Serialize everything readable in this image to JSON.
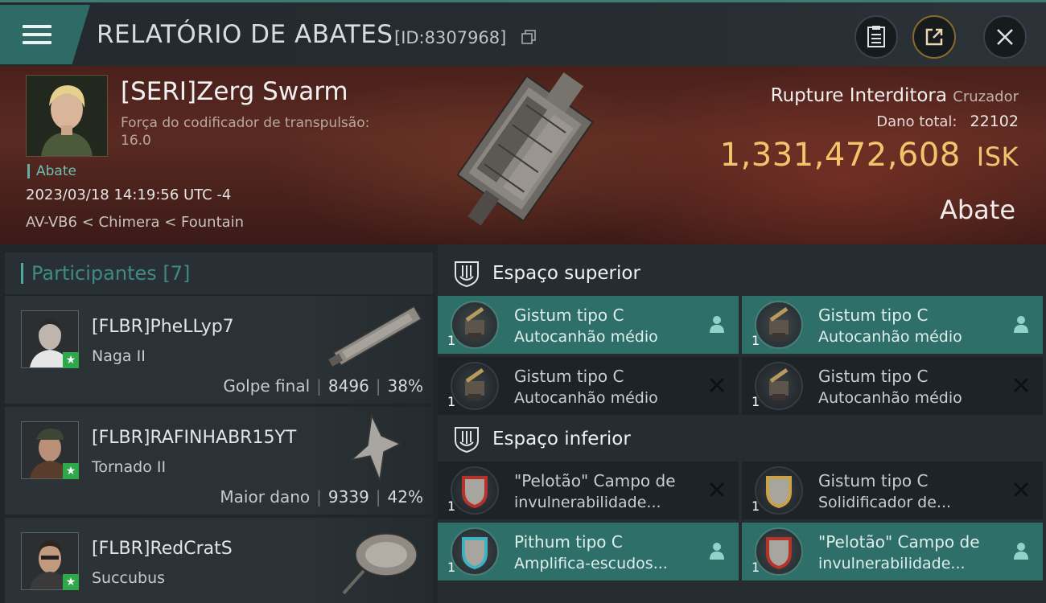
{
  "header": {
    "title": "RELATÓRIO DE ABATES",
    "report_id": "[ID:8307968]"
  },
  "victim": {
    "pilot_name": "[SERI]Zerg Swarm",
    "attribute": "Força do codificador de transpulsão: 16.0",
    "kill_tag": "Abate",
    "datetime": "2023/03/18 14:19:56 UTC -4",
    "location": "AV-VB6 < Chimera < Fountain",
    "ship_name": "Rupture Interditora",
    "ship_class": "Cruzador",
    "damage_label": "Dano total:",
    "damage_value": "22102",
    "isk_value": "1,331,472,608",
    "isk_unit": "ISK",
    "result_label": "Abate"
  },
  "participants": {
    "title": "Participantes",
    "count": "[7]",
    "rows": [
      {
        "name": "[FLBR]PheLLyp7",
        "ship": "Naga II",
        "label": "Golpe final",
        "damage": "8496",
        "percent": "38%"
      },
      {
        "name": "[FLBR]RAFINHABR15YT",
        "ship": "Tornado II",
        "label": "Maior dano",
        "damage": "9339",
        "percent": "42%"
      },
      {
        "name": "[FLBR]RedCratS",
        "ship": "Succubus"
      }
    ]
  },
  "fitting": {
    "high_slot_title": "Espaço superior",
    "low_slot_title": "Espaço inferior",
    "high_modules": [
      {
        "qty": "1",
        "line1": "Gistum tipo C",
        "line2": "Autocanhão médio",
        "state": "dropped"
      },
      {
        "qty": "1",
        "line1": "Gistum tipo C",
        "line2": "Autocanhão médio",
        "state": "dropped"
      },
      {
        "qty": "1",
        "line1": "Gistum tipo C",
        "line2": "Autocanhão médio",
        "state": "destroyed"
      },
      {
        "qty": "1",
        "line1": "Gistum tipo C",
        "line2": "Autocanhão médio",
        "state": "destroyed"
      }
    ],
    "low_modules": [
      {
        "qty": "1",
        "line1": "\"Pelotão\" Campo de",
        "line2": "invulnerabilidade...",
        "state": "destroyed"
      },
      {
        "qty": "1",
        "line1": "Gistum tipo C",
        "line2": "Solidificador de...",
        "state": "destroyed"
      },
      {
        "qty": "1",
        "line1": "Pithum tipo C",
        "line2": "Amplifica-escudos...",
        "state": "dropped"
      },
      {
        "qty": "1",
        "line1": "\"Pelotão\" Campo de",
        "line2": "invulnerabilidade...",
        "state": "dropped"
      }
    ]
  },
  "colors": {
    "accent_teal": "#2f6f6a",
    "isk_gold": "#f2c46b",
    "banner_red": "#5a2a22"
  }
}
